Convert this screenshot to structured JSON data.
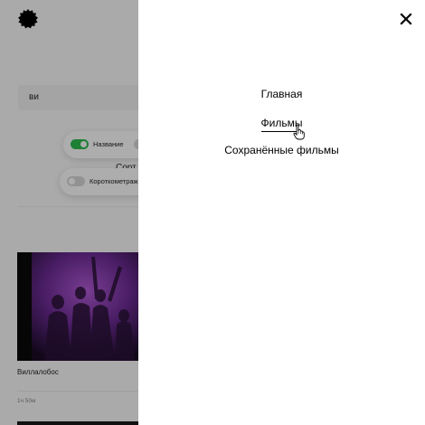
{
  "background": {
    "search": {
      "value": "ви"
    },
    "filters": [
      {
        "label": "Название",
        "toggle": "on"
      },
      {
        "label": "Короткометраж",
        "toggle": "off"
      }
    ],
    "sort_label": "Сорт",
    "movie": {
      "title": "Виллалобос",
      "duration": "1ч 50м"
    }
  },
  "menu": {
    "items": [
      {
        "label": "Главная",
        "active": false
      },
      {
        "label": "Фильмы",
        "active": true
      },
      {
        "label": "Сохранённые фильмы",
        "active": false
      }
    ],
    "close_icon": "close-icon"
  },
  "colors": {
    "toggle_on": "#2bbd4f",
    "overlay": "rgba(0,0,0,0.32)",
    "menu_bg": "#ffffff"
  }
}
